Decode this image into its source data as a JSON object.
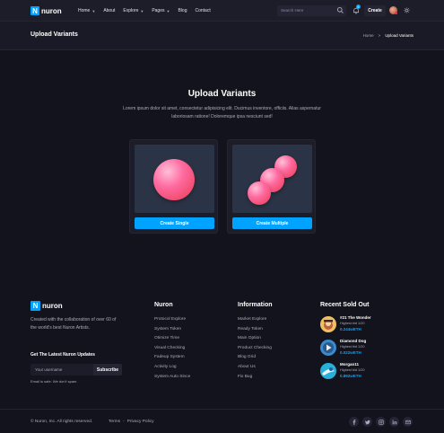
{
  "header": {
    "logo_letter": "N",
    "logo_text": "nuron",
    "nav": [
      {
        "label": "Home",
        "has_caret": true
      },
      {
        "label": "About",
        "has_caret": false
      },
      {
        "label": "Explore",
        "has_caret": true
      },
      {
        "label": "Pages",
        "has_caret": true
      },
      {
        "label": "Blog",
        "has_caret": false
      },
      {
        "label": "Contact",
        "has_caret": false
      }
    ],
    "search_placeholder": "Search Here",
    "notification_count": "6",
    "create_label": "Create",
    "accent_color": "#00a3ff"
  },
  "breadcrumb": {
    "title": "Upload Variants",
    "home": "Home",
    "separator": ">",
    "current": "Upload Variants"
  },
  "main": {
    "title": "Upload Variants",
    "description": "Lorem ipsum dolor sit amet, consectetur adipisicing elit. Ducimus inventore, officiis. Alias aspernatur laboriosam ratione! Doloremque ipsa nesciunt sed!",
    "cards": [
      {
        "button": "Create Single",
        "image": "single-sphere"
      },
      {
        "button": "Create Multiple",
        "image": "multiple-spheres"
      }
    ]
  },
  "footer": {
    "logo_letter": "N",
    "logo_text": "nuron",
    "about": "Created with the collaboration of over 60 of the world's best Nuron Artists.",
    "newsletter_title": "Get The Latest Nuron Updates",
    "email_placeholder": "Your username",
    "subscribe_label": "Subscribe",
    "note": "Email is safe. We don't spam.",
    "nuron_col": {
      "title": "Nuron",
      "links": [
        "Protocol Explore",
        "System Token",
        "Otimize Time",
        "Visual Checking",
        "Fadeup System",
        "Activity Log",
        "System Auto Since"
      ]
    },
    "info_col": {
      "title": "Information",
      "links": [
        "Market Explore",
        "Ready Token",
        "Main Option",
        "Product Checking",
        "Blog Grid",
        "About Us",
        "Fix Bug"
      ]
    },
    "sold": {
      "title": "Recent Sold Out",
      "items": [
        {
          "name": "#21 The Wonder",
          "bid": "Highest bid 1/20",
          "price": "0.244wETH"
        },
        {
          "name": "Diamond Dog",
          "bid": "Highest bid 1/20",
          "price": "0.022wETH"
        },
        {
          "name": "Morgan11",
          "bid": "Highest bid 1/20",
          "price": "0.892wETH"
        }
      ]
    },
    "copyright": "© Nuron, Inc. All rights reserved.",
    "legal": [
      "Terms",
      "-",
      "Privacy Policy"
    ],
    "socials": [
      "facebook-icon",
      "twitter-icon",
      "instagram-icon",
      "linkedin-icon",
      "mail-icon"
    ]
  }
}
